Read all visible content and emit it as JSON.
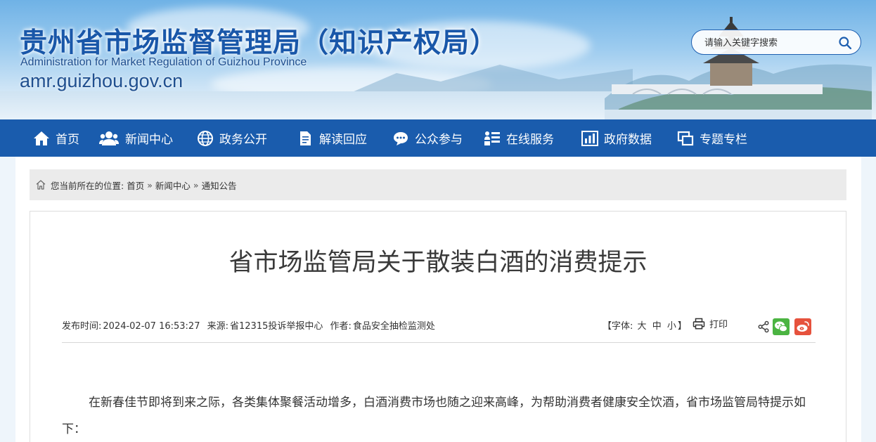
{
  "header": {
    "title": "贵州省市场监督管理局（知识产权局）",
    "subtitle": "Administration for Market Regulation of Guizhou Province",
    "domain": "amr.guizhou.gov.cn",
    "search_placeholder": "请输入关键字搜索"
  },
  "nav": {
    "items": [
      {
        "label": "首页",
        "icon": "home-icon"
      },
      {
        "label": "新闻中心",
        "icon": "people-icon"
      },
      {
        "label": "政务公开",
        "icon": "globe-icon"
      },
      {
        "label": "解读回应",
        "icon": "document-icon"
      },
      {
        "label": "公众参与",
        "icon": "chat-icon"
      },
      {
        "label": "在线服务",
        "icon": "service-list-icon"
      },
      {
        "label": "政府数据",
        "icon": "bar-chart-icon"
      },
      {
        "label": "专题专栏",
        "icon": "windows-icon"
      }
    ]
  },
  "breadcrumb": {
    "prefix": "您当前所在的位置:",
    "items": [
      "首页",
      "新闻中心",
      "通知公告"
    ],
    "separator": "»"
  },
  "article": {
    "title": "省市场监管局关于散装白酒的消费提示",
    "publish_label": "发布时间:",
    "publish_time": "2024-02-07 16:53:27",
    "source_label": "来源:",
    "source": "省12315投诉举报中心",
    "author_label": "作者:",
    "author": "食品安全抽检监测处",
    "font_size_label": "【字体:",
    "font_size_large": "大",
    "font_size_medium": "中",
    "font_size_small": "小",
    "font_size_close": "】",
    "print_label": "打印",
    "body": "在新春佳节即将到来之际，各类集体聚餐活动增多，白酒消费市场也随之迎来高峰，为帮助消费者健康安全饮酒，省市场监管局特提示如下："
  },
  "colors": {
    "nav_bg": "#1a5cad",
    "title_blue": "#1957a9",
    "wechat_green": "#4bb442",
    "weibo_red": "#e6523d"
  }
}
